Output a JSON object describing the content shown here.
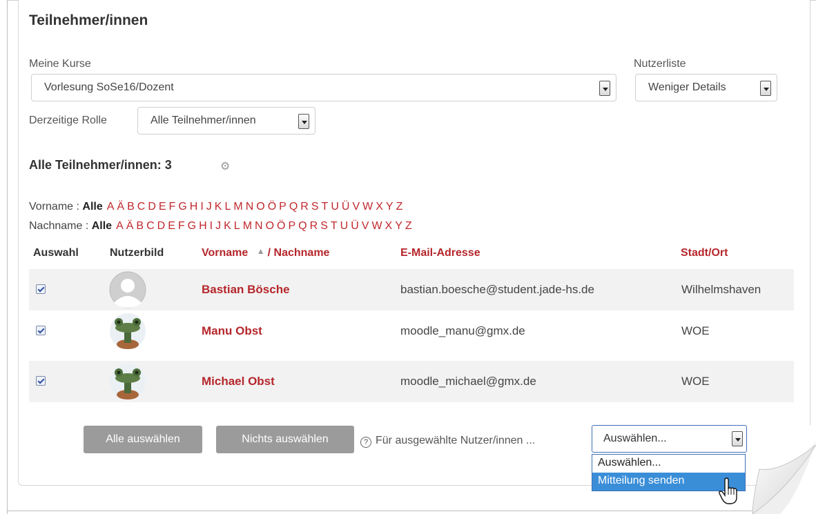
{
  "page": {
    "title": "Teilnehmer/innen"
  },
  "filters": {
    "my_courses_label": "Meine Kurse",
    "my_courses_value": "Vorlesung SoSe16/Dozent",
    "user_list_label": "Nutzerliste",
    "user_list_value": "Weniger Details",
    "current_role_label": "Derzeitige Rolle",
    "current_role_value": "Alle Teilnehmer/innen"
  },
  "participants": {
    "count_label": "Alle Teilnehmer/innen: 3",
    "gear_icon": "gear-icon"
  },
  "initials": {
    "firstname_label": "Vorname :",
    "lastname_label": "Nachname :",
    "all_label": "Alle",
    "letters": [
      "A",
      "Ä",
      "B",
      "C",
      "D",
      "E",
      "F",
      "G",
      "H",
      "I",
      "J",
      "K",
      "L",
      "M",
      "N",
      "O",
      "Ö",
      "P",
      "Q",
      "R",
      "S",
      "T",
      "U",
      "Ü",
      "V",
      "W",
      "X",
      "Y",
      "Z"
    ]
  },
  "table": {
    "headers": {
      "select": "Auswahl",
      "picture": "Nutzerbild",
      "firstname": "Vorname",
      "separator": "/",
      "lastname": "Nachname",
      "email": "E-Mail-Adresse",
      "city": "Stadt/Ort"
    },
    "rows": [
      {
        "name": "Bastian Bösche",
        "email": "bastian.boesche@student.jade-hs.de",
        "city": "Wilhelmshaven",
        "checked": true,
        "avatar": "default-avatar-icon"
      },
      {
        "name": "Manu Obst",
        "email": "moodle_manu@gmx.de",
        "city": "WOE",
        "checked": true,
        "avatar": "frog-avatar"
      },
      {
        "name": "Michael Obst",
        "email": "moodle_michael@gmx.de",
        "city": "WOE",
        "checked": true,
        "avatar": "frog-avatar"
      }
    ]
  },
  "actions": {
    "select_all": "Alle auswählen",
    "select_none": "Nichts auswählen",
    "with_selected": "Für ausgewählte Nutzer/innen ...",
    "dropdown_value": "Auswählen...",
    "dropdown_options": [
      "Auswählen...",
      "Mitteilung senden"
    ],
    "highlighted_option": "Mitteilung senden"
  },
  "colors": {
    "link_red": "#b5262b",
    "button_gray": "#9b9b9b",
    "option_highlight": "#3a8ed8"
  }
}
